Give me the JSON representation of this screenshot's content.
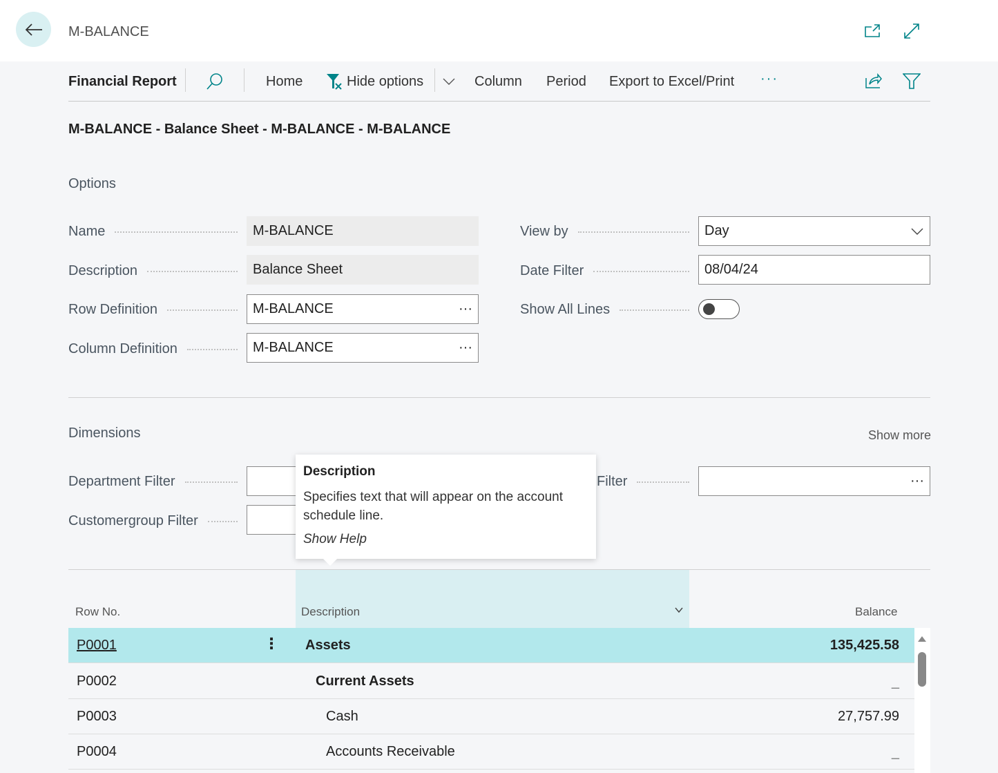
{
  "header": {
    "title": "M-BALANCE",
    "icons": [
      "back-arrow-icon",
      "open-in-new-window-icon",
      "expand-icon"
    ]
  },
  "actionbar": {
    "title": "Financial Report",
    "items": [
      "Home",
      "Hide options",
      "Column",
      "Period",
      "Export to Excel/Print"
    ],
    "more": "···"
  },
  "page_title": "M-BALANCE - Balance Sheet - M-BALANCE - M-BALANCE",
  "options": {
    "heading": "Options",
    "name_label": "Name",
    "name_value": "M-BALANCE",
    "description_label": "Description",
    "description_value": "Balance Sheet",
    "rowdef_label": "Row Definition",
    "rowdef_value": "M-BALANCE",
    "coldef_label": "Column Definition",
    "coldef_value": "M-BALANCE",
    "viewby_label": "View by",
    "viewby_value": "Day",
    "datefilter_label": "Date Filter",
    "datefilter_value": "08/04/24",
    "showall_label": "Show All Lines",
    "showall_on": false
  },
  "dimensions": {
    "heading": "Dimensions",
    "show_more": "Show more",
    "dept_label": "Department Filter",
    "custgroup_label": "Customergroup Filter",
    "filter_label": "Filter"
  },
  "tooltip": {
    "title": "Description",
    "text": "Specifies text that will appear on the account schedule line.",
    "help": "Show Help"
  },
  "table": {
    "columns": [
      "Row No.",
      "Description",
      "Balance"
    ],
    "rows": [
      {
        "no": "P0001",
        "desc": "Assets",
        "balance": "135,425.58",
        "bold": true
      },
      {
        "no": "P0002",
        "desc": "Current Assets",
        "balance": "_",
        "bold": true
      },
      {
        "no": "P0003",
        "desc": "Cash",
        "balance": "27,757.99",
        "bold": false
      },
      {
        "no": "P0004",
        "desc": "Accounts Receivable",
        "balance": "_",
        "bold": false
      }
    ]
  },
  "colors": {
    "accent": "#008489",
    "selected_row": "#b2e8ec",
    "column_highlight": "#d9eff2"
  }
}
